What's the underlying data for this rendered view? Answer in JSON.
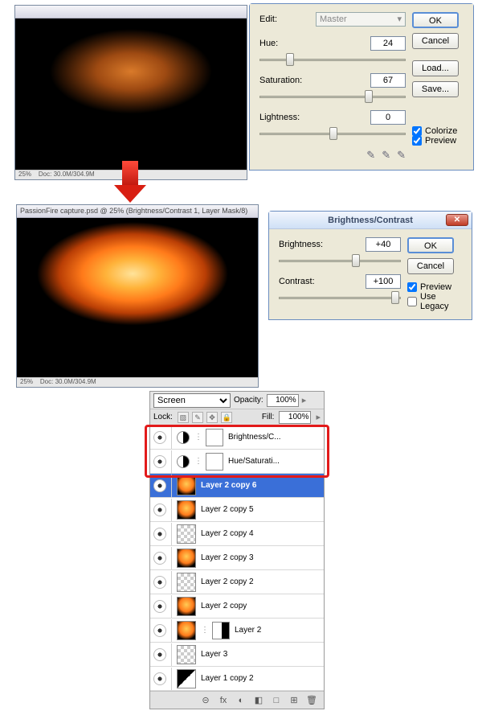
{
  "hue_sat": {
    "edit_label": "Edit:",
    "edit_value": "Master",
    "hue_label": "Hue:",
    "hue_value": "24",
    "sat_label": "Saturation:",
    "sat_value": "67",
    "light_label": "Lightness:",
    "light_value": "0",
    "ok": "OK",
    "cancel": "Cancel",
    "load": "Load...",
    "save": "Save...",
    "colorize": "Colorize",
    "preview": "Preview"
  },
  "bc": {
    "title": "Brightness/Contrast",
    "brightness_label": "Brightness:",
    "brightness_value": "+40",
    "contrast_label": "Contrast:",
    "contrast_value": "+100",
    "ok": "OK",
    "cancel": "Cancel",
    "preview": "Preview",
    "legacy": "Use Legacy"
  },
  "preview1": {
    "status_left": "25%",
    "status_right": "Doc: 30.0M/304.9M"
  },
  "preview2": {
    "title": "PassionFire capture.psd @ 25% (Brightness/Contrast 1, Layer Mask/8)",
    "status_left": "25%",
    "status_right": "Doc: 30.0M/304.9M"
  },
  "layers": {
    "blend_mode": "Screen",
    "opacity_label": "Opacity:",
    "opacity_value": "100%",
    "lock_label": "Lock:",
    "fill_label": "Fill:",
    "fill_value": "100%",
    "items": [
      {
        "name": "Brightness/C...",
        "type": "adjust"
      },
      {
        "name": "Hue/Saturati...",
        "type": "adjust"
      },
      {
        "name": "Layer 2 copy 6",
        "type": "fire",
        "selected": true
      },
      {
        "name": "Layer 2 copy 5",
        "type": "fire"
      },
      {
        "name": "Layer 2 copy 4",
        "type": "checker"
      },
      {
        "name": "Layer 2 copy 3",
        "type": "fire"
      },
      {
        "name": "Layer 2 copy 2",
        "type": "checker"
      },
      {
        "name": "Layer 2 copy",
        "type": "fire"
      },
      {
        "name": "Layer 2",
        "type": "fire",
        "mask": true
      },
      {
        "name": "Layer 3",
        "type": "checker"
      },
      {
        "name": "Layer 1 copy 2",
        "type": "bw"
      }
    ],
    "foot_icons": [
      "⊕",
      "fx",
      "◑",
      "◧",
      "□",
      "⊞",
      "🗑"
    ]
  }
}
